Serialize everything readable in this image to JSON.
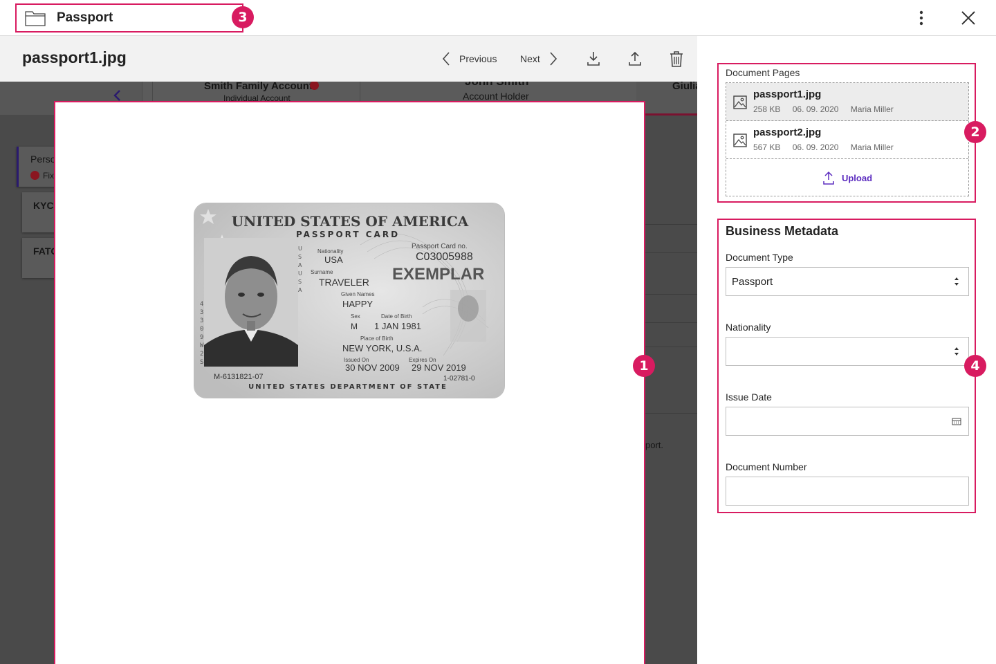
{
  "header": {
    "title": "Passport",
    "marker": "3",
    "more_icon": "kebab-menu-icon",
    "close_icon": "close-icon"
  },
  "viewer_toolbar": {
    "file_name": "passport1.jpg",
    "previous_label": "Previous",
    "next_label": "Next",
    "download_icon": "download-icon",
    "upload_icon": "upload-icon",
    "delete_icon": "trash-icon"
  },
  "background_app": {
    "tab1_title": "Smith Family Account",
    "tab1_sub": "Individual Account",
    "tab2_title": "John Smith",
    "tab2_sub": "Account Holder",
    "tab3_title": "Giulia",
    "side1": "Perso",
    "side1_sub": "Fix",
    "side2": "KYC",
    "side3": "FATC",
    "fragment": "port."
  },
  "viewer": {
    "marker": "1",
    "card": {
      "header": "UNITED STATES OF AMERICA",
      "subheader": "PASSPORT CARD",
      "nationality_label": "Nationality",
      "nationality": "USA",
      "card_no_label": "Passport Card no.",
      "card_no": "C03005988",
      "surname_label": "Surname",
      "surname": "TRAVELER",
      "exemplar": "EXEMPLAR",
      "given_label": "Given Names",
      "given": "HAPPY",
      "sex_label": "Sex",
      "sex": "M",
      "dob_label": "Date of Birth",
      "dob": "1 JAN 1981",
      "pob_label": "Place of Birth",
      "pob": "NEW YORK, U.S.A.",
      "issued_label": "Issued On",
      "issued": "30 NOV 2009",
      "expires_label": "Expires On",
      "expires": "29 NOV 2019",
      "code_left": "M-6131821-07",
      "code_right": "1-02781-0",
      "footer": "UNITED STATES DEPARTMENT OF STATE"
    }
  },
  "document_pages": {
    "label": "Document Pages",
    "marker": "2",
    "pages": [
      {
        "name": "passport1.jpg",
        "size": "258 KB",
        "date": "06. 09. 2020",
        "author": "Maria Miller",
        "selected": true
      },
      {
        "name": "passport2.jpg",
        "size": "567 KB",
        "date": "06. 09. 2020",
        "author": "Maria Miller",
        "selected": false
      }
    ],
    "upload_label": "Upload"
  },
  "business_metadata": {
    "title": "Business Metadata",
    "marker": "4",
    "document_type_label": "Document Type",
    "document_type_value": "Passport",
    "nationality_label": "Nationality",
    "nationality_value": "",
    "issue_date_label": "Issue Date",
    "issue_date_value": "",
    "document_number_label": "Document Number",
    "document_number_value": ""
  },
  "colors": {
    "accent": "#d81b60",
    "link": "#5b2bbf"
  }
}
